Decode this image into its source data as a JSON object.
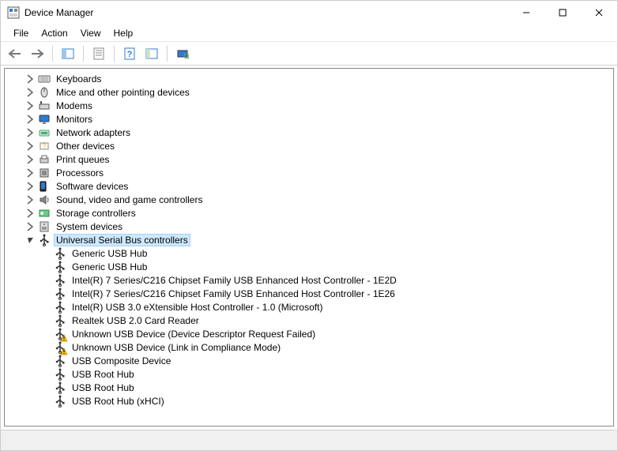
{
  "window": {
    "title": "Device Manager"
  },
  "menu": {
    "file": "File",
    "action": "Action",
    "view": "View",
    "help": "Help"
  },
  "toolbar": {
    "back": "Back",
    "forward": "Forward",
    "show_hide": "Show/Hide Console Tree",
    "properties": "Properties",
    "help": "Help",
    "refresh": "Refresh",
    "scan": "Scan for hardware changes"
  },
  "categories": [
    {
      "label": "Keyboards",
      "icon": "keyboard-icon",
      "children": []
    },
    {
      "label": "Mice and other pointing devices",
      "icon": "mouse-icon",
      "children": []
    },
    {
      "label": "Modems",
      "icon": "modem-icon",
      "children": []
    },
    {
      "label": "Monitors",
      "icon": "monitor-icon",
      "children": []
    },
    {
      "label": "Network adapters",
      "icon": "network-icon",
      "children": []
    },
    {
      "label": "Other devices",
      "icon": "other-icon",
      "children": []
    },
    {
      "label": "Print queues",
      "icon": "printer-icon",
      "children": []
    },
    {
      "label": "Processors",
      "icon": "cpu-icon",
      "children": []
    },
    {
      "label": "Software devices",
      "icon": "software-icon",
      "children": []
    },
    {
      "label": "Sound, video and game controllers",
      "icon": "sound-icon",
      "children": []
    },
    {
      "label": "Storage controllers",
      "icon": "storage-icon",
      "children": []
    },
    {
      "label": "System devices",
      "icon": "system-icon",
      "children": []
    },
    {
      "label": "Universal Serial Bus controllers",
      "icon": "usb-icon",
      "expanded": true,
      "selected": true,
      "children": [
        {
          "label": "Generic USB Hub",
          "icon": "usb-icon",
          "warn": false
        },
        {
          "label": "Generic USB Hub",
          "icon": "usb-icon",
          "warn": false
        },
        {
          "label": "Intel(R) 7 Series/C216 Chipset Family USB Enhanced Host Controller - 1E2D",
          "icon": "usb-icon",
          "warn": false
        },
        {
          "label": "Intel(R) 7 Series/C216 Chipset Family USB Enhanced Host Controller - 1E26",
          "icon": "usb-icon",
          "warn": false
        },
        {
          "label": "Intel(R) USB 3.0 eXtensible Host Controller - 1.0 (Microsoft)",
          "icon": "usb-icon",
          "warn": false
        },
        {
          "label": "Realtek USB 2.0 Card Reader",
          "icon": "usb-icon",
          "warn": false
        },
        {
          "label": "Unknown USB Device (Device Descriptor Request Failed)",
          "icon": "usb-icon",
          "warn": true
        },
        {
          "label": "Unknown USB Device (Link in Compliance Mode)",
          "icon": "usb-icon",
          "warn": true
        },
        {
          "label": "USB Composite Device",
          "icon": "usb-icon",
          "warn": false
        },
        {
          "label": "USB Root Hub",
          "icon": "usb-icon",
          "warn": false
        },
        {
          "label": "USB Root Hub",
          "icon": "usb-icon",
          "warn": false
        },
        {
          "label": "USB Root Hub (xHCI)",
          "icon": "usb-icon",
          "warn": false
        }
      ]
    }
  ]
}
